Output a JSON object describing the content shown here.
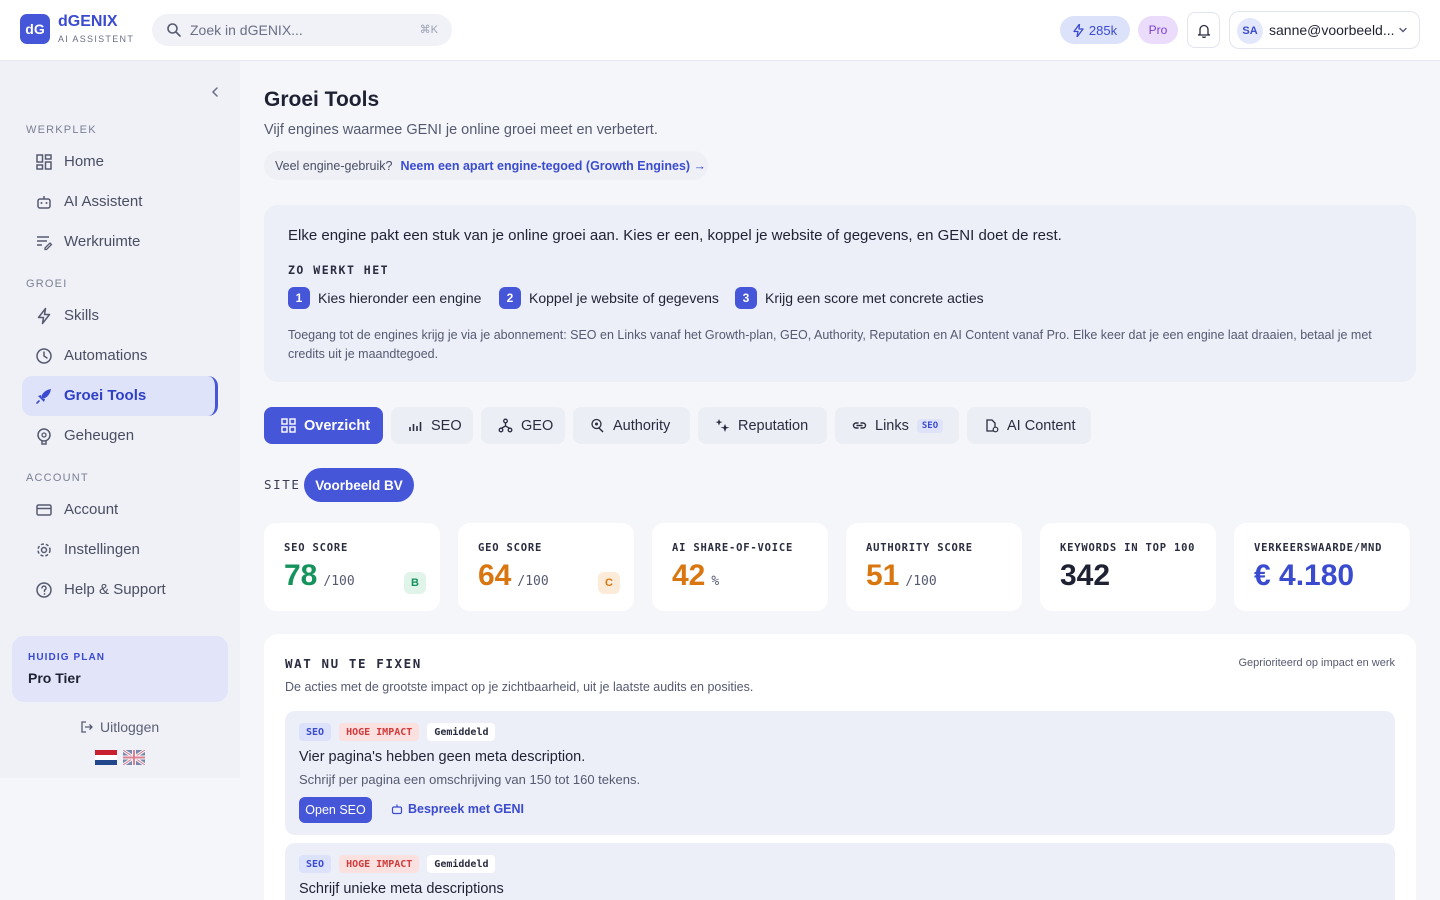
{
  "header": {
    "logo_mark": "dG",
    "app_name": "dGENIX",
    "app_subtitle": "AI ASSISTENT",
    "search_placeholder": "Zoek in dGENIX...",
    "search_shortcut": "⌘K",
    "credits": "285k",
    "plan_badge": "Pro",
    "avatar_initials": "SA",
    "user_email": "sanne@voorbeeld..."
  },
  "sidebar": {
    "sections": {
      "werkplek": "WERKPLEK",
      "groei": "GROEI",
      "account": "ACCOUNT"
    },
    "items": [
      {
        "label": "Home",
        "icon": "dashboard-icon"
      },
      {
        "label": "AI Assistent",
        "icon": "robot-icon"
      },
      {
        "label": "Werkruimte",
        "icon": "edit-list-icon"
      },
      {
        "label": "Skills",
        "icon": "bolt-icon"
      },
      {
        "label": "Automations",
        "icon": "clock-icon"
      },
      {
        "label": "Groei Tools",
        "icon": "rocket-icon",
        "active": true
      },
      {
        "label": "Geheugen",
        "icon": "brain-icon"
      },
      {
        "label": "Account",
        "icon": "card-icon"
      },
      {
        "label": "Instellingen",
        "icon": "gear-icon"
      },
      {
        "label": "Help & Support",
        "icon": "help-icon"
      }
    ],
    "plan_label": "HUIDIG PLAN",
    "plan_value": "Pro Tier",
    "logout": "Uitloggen"
  },
  "page": {
    "title": "Groei Tools",
    "subtitle": "Vijf engines waarmee GENI je online groei meet en verbetert.",
    "promo_question": "Veel engine-gebruik?",
    "promo_link": "Neem een apart engine-tegoed (Growth Engines) →"
  },
  "info": {
    "lead": "Elke engine pakt een stuk van je online groei aan. Kies er een, koppel je website of gegevens, en GENI doet de rest.",
    "how_label": "ZO WERKT HET",
    "steps": [
      {
        "num": "1",
        "text": "Kies hieronder een engine"
      },
      {
        "num": "2",
        "text": "Koppel je website of gegevens"
      },
      {
        "num": "3",
        "text": "Krijg een score met concrete acties"
      }
    ],
    "note": "Toegang tot de engines krijg je via je abonnement: SEO en Links vanaf het Growth-plan, GEO, Authority, Reputation en AI Content vanaf Pro. Elke keer dat je een engine laat draaien, betaal je met credits uit je maandtegoed."
  },
  "tabs": [
    {
      "label": "Overzicht",
      "icon": "grid-icon",
      "active": true
    },
    {
      "label": "SEO",
      "icon": "bar-chart-icon"
    },
    {
      "label": "GEO",
      "icon": "network-icon"
    },
    {
      "label": "Authority",
      "icon": "badge-icon"
    },
    {
      "label": "Reputation",
      "icon": "stars-icon"
    },
    {
      "label": "Links",
      "icon": "link-icon",
      "badge": "SEO"
    },
    {
      "label": "AI Content",
      "icon": "content-icon"
    }
  ],
  "site": {
    "label": "SITE",
    "value": "Voorbeeld BV"
  },
  "metrics": [
    {
      "label": "SEO SCORE",
      "value": "78",
      "unit": "/100",
      "grade": "B",
      "color": "#14935c",
      "grade_bg": "#e0f4ea",
      "grade_color": "#14935c"
    },
    {
      "label": "GEO SCORE",
      "value": "64",
      "unit": "/100",
      "grade": "C",
      "color": "#d9760f",
      "grade_bg": "#fdebd9",
      "grade_color": "#d9760f"
    },
    {
      "label": "AI SHARE-OF-VOICE",
      "value": "42",
      "unit": "%",
      "color": "#d9760f"
    },
    {
      "label": "AUTHORITY SCORE",
      "value": "51",
      "unit": "/100",
      "color": "#d9760f"
    },
    {
      "label": "KEYWORDS IN TOP 100",
      "value": "342",
      "unit": "",
      "color": "#1f2233"
    },
    {
      "label": "VERKEERSWAARDE/MND",
      "value": "€ 4.180",
      "unit": "",
      "color": "#3a4bcf"
    }
  ],
  "fixes": {
    "title": "WAT NU TE FIXEN",
    "right": "Geprioriteerd op impact en werk",
    "subtitle": "De acties met de grootste impact op je zichtbaarheid, uit je laatste audits en posities.",
    "items": [
      {
        "tags": [
          "SEO",
          "HOGE IMPACT",
          "Gemiddeld"
        ],
        "title": "Vier pagina's hebben geen meta description.",
        "desc": "Schrijf per pagina een omschrijving van 150 tot 160 tekens.",
        "primary": "Open SEO",
        "secondary": "Bespreek met GENI"
      },
      {
        "tags": [
          "SEO",
          "HOGE IMPACT",
          "Gemiddeld"
        ],
        "title": "Schrijf unieke meta descriptions"
      }
    ]
  }
}
